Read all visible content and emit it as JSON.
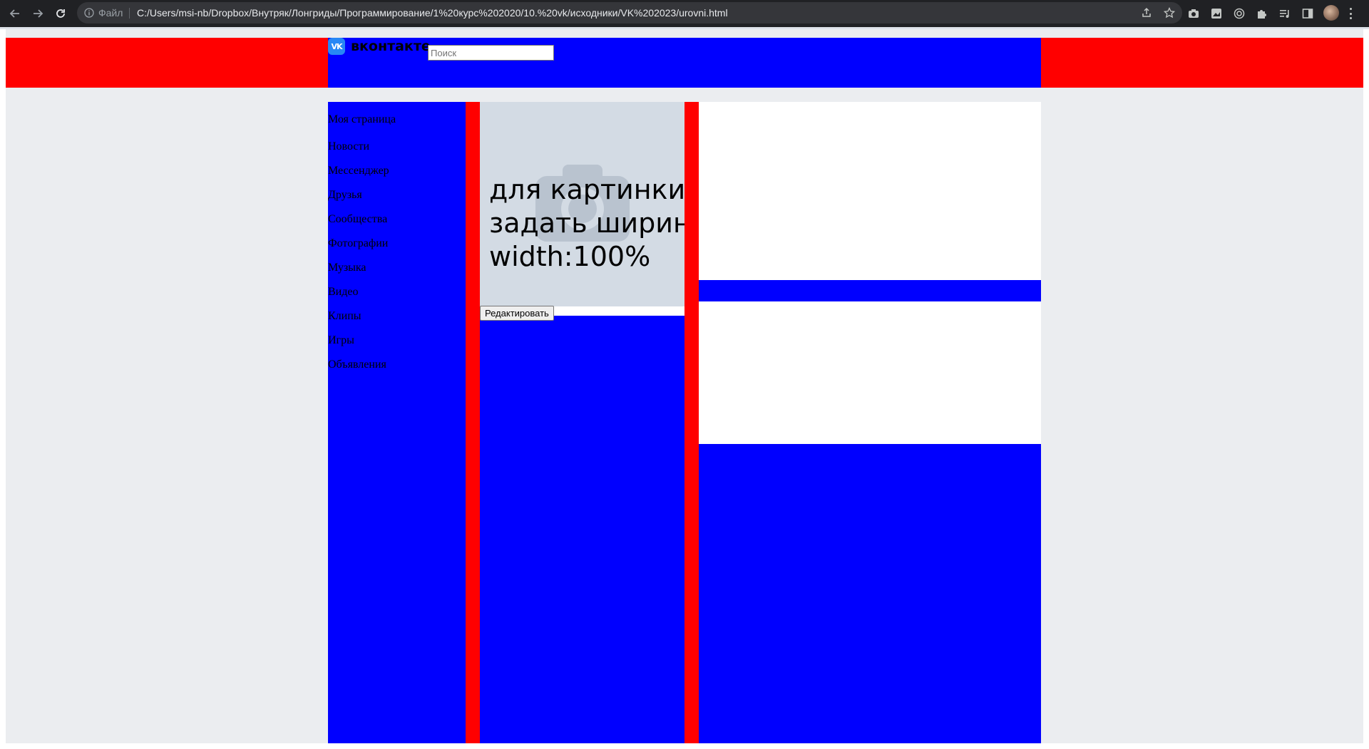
{
  "browser": {
    "file_label": "Файл",
    "url": "C:/Users/msi-nb/Dropbox/Внутряк/Лонгриды/Программирование/1%20курс%202020/10.%20vk/исходники/VK%202023/urovni.html",
    "icons": {
      "back": "back-arrow-icon",
      "forward": "forward-arrow-icon",
      "reload": "reload-icon",
      "info": "info-icon",
      "share": "share-icon",
      "bookmark": "star-icon",
      "extensions": [
        "camera-icon",
        "screenshot-icon",
        "target-icon",
        "puzzle-icon",
        "media-icon",
        "sidepanel-icon"
      ],
      "profile": "avatar",
      "menu": "kebab-menu-icon"
    }
  },
  "header": {
    "logo_icon_text": "VK",
    "logo_text": "вконтакте",
    "search_placeholder": "Поиск"
  },
  "sidebar": {
    "items": [
      {
        "label": "Моя страница"
      },
      {
        "label": "Новости"
      },
      {
        "label": "Мессенджер"
      },
      {
        "label": "Друзья"
      },
      {
        "label": "Сообщества"
      },
      {
        "label": "Фотографии"
      },
      {
        "label": "Музыка"
      },
      {
        "label": "Видео"
      },
      {
        "label": "Клипы"
      },
      {
        "label": "Игры"
      },
      {
        "label": "Объявления"
      }
    ]
  },
  "profile": {
    "photo_caption_lines": [
      "для картинки",
      "задать ширину",
      "width:100%"
    ],
    "edit_button": "Редактировать"
  },
  "colors": {
    "header_band": "#ff0000",
    "content_blue": "#0000ff",
    "separator_red": "#ff0000",
    "page_background": "#ebedf0",
    "photo_placeholder": "#d3dbe4",
    "vk_brand": "#2787f5"
  }
}
